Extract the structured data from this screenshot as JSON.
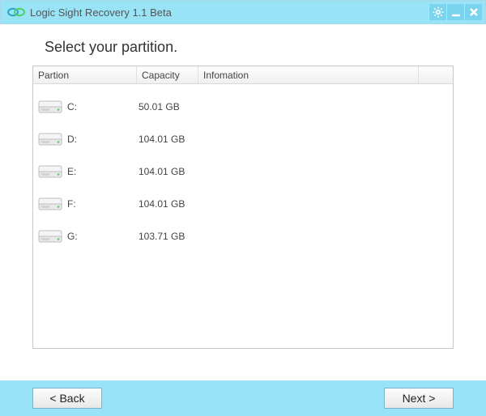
{
  "app": {
    "title": "Logic Sight Recovery   1.1 Beta"
  },
  "heading": "Select your partition.",
  "columns": {
    "partition": "Partion",
    "capacity": "Capacity",
    "info": "Infomation"
  },
  "partitions": [
    {
      "label": "C:",
      "capacity": "50.01 GB",
      "info": ""
    },
    {
      "label": "D:",
      "capacity": "104.01 GB",
      "info": ""
    },
    {
      "label": "E:",
      "capacity": "104.01 GB",
      "info": ""
    },
    {
      "label": "F:",
      "capacity": "104.01 GB",
      "info": ""
    },
    {
      "label": "G:",
      "capacity": "103.71 GB",
      "info": ""
    }
  ],
  "buttons": {
    "back": "< Back",
    "next": "Next >"
  }
}
